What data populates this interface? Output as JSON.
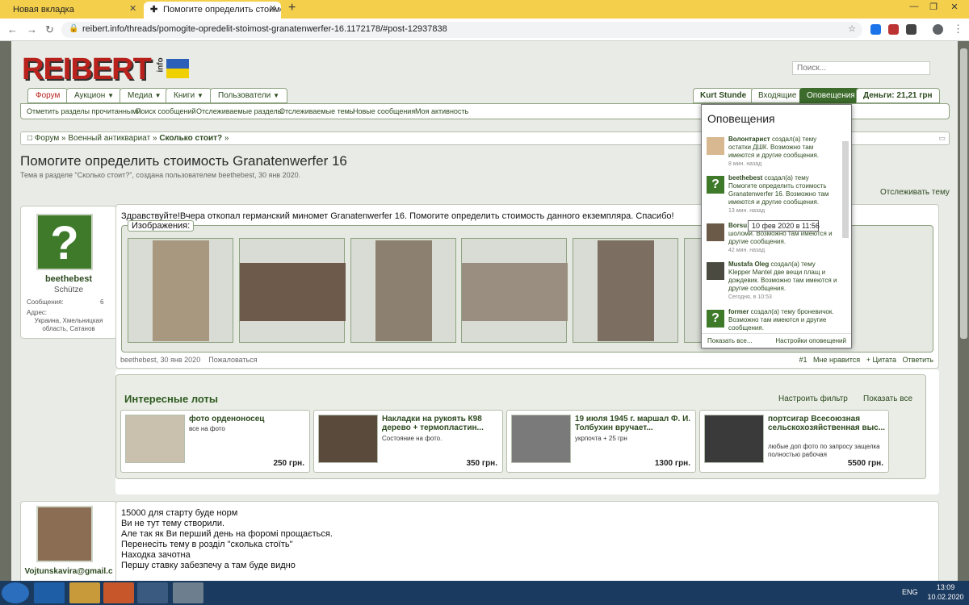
{
  "browser": {
    "tabs": [
      {
        "label": "Новая вкладка"
      },
      {
        "label": "Помогите определить стоимость"
      }
    ],
    "new_tab": "+",
    "url": "reibert.info/threads/pomogite-opredelit-stoimost-granatenwerfer-16.1172178/#post-12937838"
  },
  "site": {
    "logo": "REIBERT",
    "logo_suffix": "info",
    "search_placeholder": "Поиск...",
    "nav_tabs": [
      "Форум",
      "Аукцион",
      "Медиа",
      "Книги",
      "Пользователи"
    ],
    "sub_nav": [
      "Отметить разделы прочитанными",
      "Поиск сообщений",
      "Отслеживаемые разделы",
      "Отслеживаемые темы",
      "Новые сообщения",
      "Моя активность"
    ],
    "right_tabs": [
      "Kurt Stunde",
      "Входящие",
      "Оповещения",
      "Деньги: 21,21 грн"
    ],
    "breadcrumb": [
      "Форум",
      "Военный антиквариат",
      "Сколько стоит?"
    ],
    "thread_title": "Помогите определить стоимость Granatenwerfer 16",
    "thread_subtitle": "Тема в разделе \"Сколько стоит?\", создана пользователем beethebest, 30 янв 2020.",
    "watch_label": "Отслеживать тему"
  },
  "post1": {
    "author": "beethebest",
    "role": "Schütze",
    "messages_label": "Сообщения:",
    "messages": "6",
    "address_label": "Адрес:",
    "address": "Украина, Хмельницкая область, Сатанов",
    "text": "Здравствуйте!Вчера откопал германский миномет Granatenwerfer 16. Помогите определить стоимость данного екземпляра. Спасибо!",
    "images_label": "Изображения:",
    "meta_date": "beethebest, 30 янв 2020",
    "report": "Пожаловаться",
    "post_no": "#1",
    "like": "Мне нравится",
    "quote": "+ Цитата",
    "reply": "Ответить"
  },
  "lots": {
    "title": "Интересные лоты",
    "filter": "Настроить фильтр",
    "show_all": "Показать все",
    "items": [
      {
        "title": "фото орденоносец",
        "desc": "все на фото",
        "price": "250 грн."
      },
      {
        "title": "Накладки на рукоять К98 дерево + термопластин...",
        "desc": "Состояние на фото.",
        "price": "350 грн."
      },
      {
        "title": "19 июля 1945 г. маршал Ф. И. Толбухин вручает...",
        "desc": "укрпочта + 25 грн",
        "price": "1300 грн."
      },
      {
        "title": "портсигар Всесоюзная сельскохозяйственная выс...",
        "desc": "любые доп фото по запросу защелка полностью рабочая",
        "price": "5500 грн."
      }
    ]
  },
  "post2": {
    "author": "Vojtunskavira@gmail.c",
    "lines": [
      "15000 для старту буде норм",
      "Ви не тут тему створили.",
      "Але так як Ви перший день на форомі прощається.",
      "Перенесіть тему в розділ \"сколька стоїть\"",
      "Находка зачотна",
      "Першу ставку забезпечу а там буде видно"
    ]
  },
  "notifications": {
    "title": "Оповещения",
    "items": [
      {
        "user": "Волонтарист",
        "text": "создал(а) тему остатки ДШК. Возможно там имеются и другие сообщения.",
        "time": "8 мин. назад"
      },
      {
        "user": "beethebest",
        "text": "создал(а) тему Помогите определить стоимость Granatenwerfer 16. Возможно там имеются и другие сообщения.",
        "time": "13 мин. назад"
      },
      {
        "user": "Borsu",
        "text": "Підкажіть по лікерам шоломи. Возможно там имеются и другие сообщения.",
        "time": "42 мин. назад"
      },
      {
        "user": "Mustafa Oleg",
        "text": "создал(а) тему Klepper Mantel две вещи плащ и дождевик. Возможно там имеются и другие сообщения.",
        "time": "Сегодня, в 10:53"
      },
      {
        "user": "former",
        "text": "создал(а) тему броневичок. Возможно там имеются и другие сообщения.",
        "time": ""
      }
    ],
    "show_all": "Показать все...",
    "settings": "Настройки оповещений",
    "tooltip": "10 фев 2020 в 11:56"
  },
  "taskbar": {
    "lang": "ENG",
    "time": "13:09",
    "date": "10.02.2020"
  }
}
